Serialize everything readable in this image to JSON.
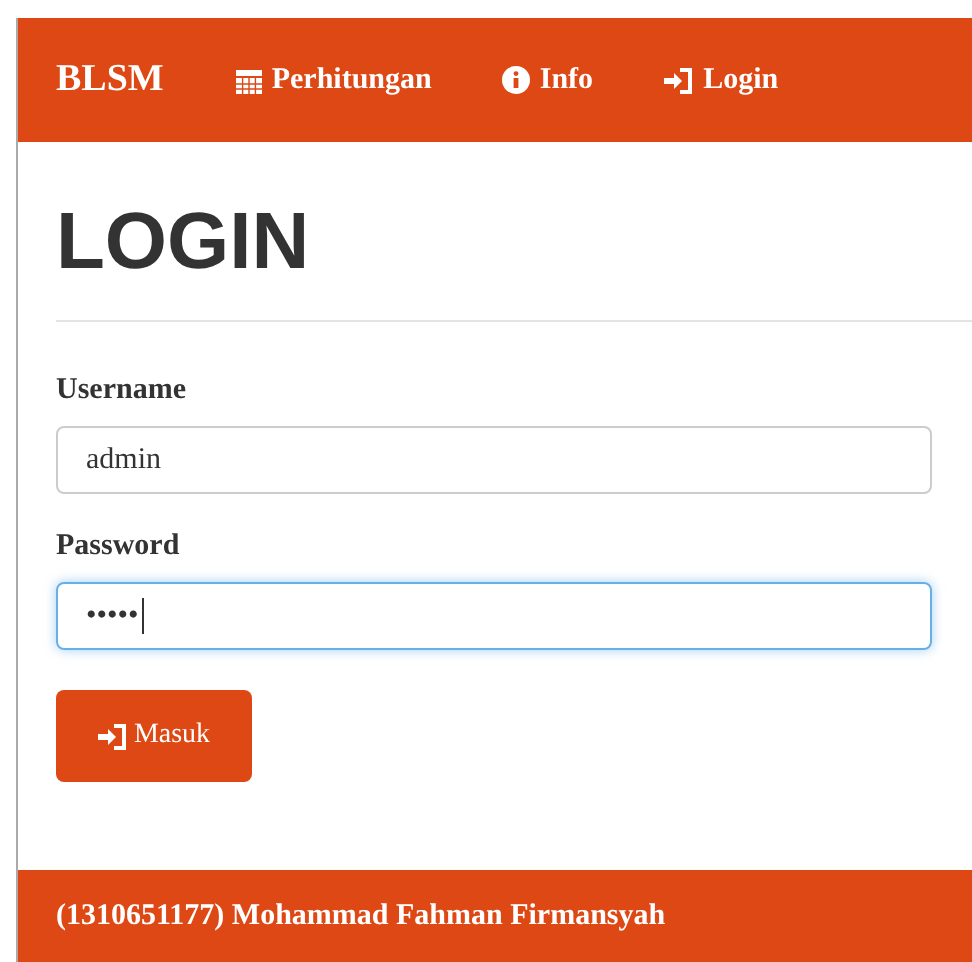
{
  "navbar": {
    "brand": "BLSM",
    "items": [
      {
        "label": "Perhitungan",
        "kind": "calendar"
      },
      {
        "label": "Info",
        "kind": "info"
      },
      {
        "label": "Login",
        "kind": "login"
      }
    ]
  },
  "heading": "LOGIN",
  "form": {
    "fields": [
      {
        "label": "Username",
        "value": "admin",
        "focused": false
      },
      {
        "label": "Password",
        "value": "•••••",
        "focused": true
      }
    ],
    "button": "Masuk"
  },
  "footer": "(1310651177) Mohammad Fahman Firmansyah"
}
